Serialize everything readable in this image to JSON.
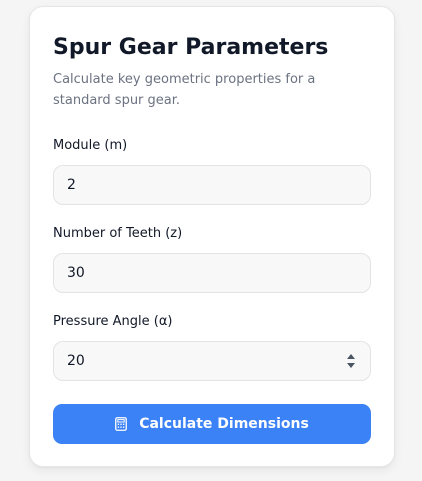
{
  "card": {
    "title": "Spur Gear Parameters",
    "subtitle": "Calculate key geometric properties for a standard spur gear."
  },
  "fields": {
    "module": {
      "label": "Module (m)",
      "value": "2"
    },
    "teeth": {
      "label": "Number of Teeth (z)",
      "value": "30"
    },
    "pressure_angle": {
      "label": "Pressure Angle (α)",
      "value": "20"
    }
  },
  "button": {
    "label": "Calculate Dimensions",
    "icon": "calculator-icon"
  },
  "colors": {
    "accent": "#3b82f6",
    "background": "#f5f5f5",
    "card": "#ffffff",
    "input_bg": "#f8f8f8",
    "text": "#111827",
    "muted": "#6b7280"
  }
}
